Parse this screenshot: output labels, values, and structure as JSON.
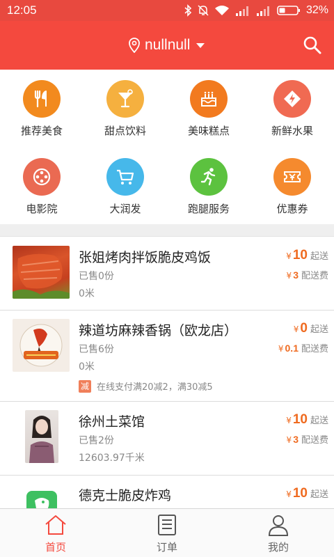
{
  "status_bar": {
    "time": "12:05",
    "battery": "32%"
  },
  "header": {
    "location": "nullnull"
  },
  "categories": [
    {
      "label": "推荐美食",
      "icon": "fork-knife-icon",
      "color": "#f28a1e"
    },
    {
      "label": "甜点饮料",
      "icon": "cocktail-icon",
      "color": "#f5b03f"
    },
    {
      "label": "美味糕点",
      "icon": "cake-icon",
      "color": "#f27a1f"
    },
    {
      "label": "新鲜水果",
      "icon": "lightning-tag-icon",
      "color": "#f06a52"
    },
    {
      "label": "电影院",
      "icon": "film-reel-icon",
      "color": "#ea6a52"
    },
    {
      "label": "大润发",
      "icon": "cart-icon",
      "color": "#46b8ea"
    },
    {
      "label": "跑腿服务",
      "icon": "runner-icon",
      "color": "#5cc23f"
    },
    {
      "label": "优惠券",
      "icon": "coupon-icon",
      "color": "#f58a2e"
    }
  ],
  "shops": [
    {
      "name": "张姐烤肉拌饭脆皮鸡饭",
      "sold": "已售0份",
      "distance": "0米",
      "min_price": "10",
      "min_unit": "起送",
      "delivery_fee": "3",
      "fee_unit": "配送费",
      "currency": "¥"
    },
    {
      "name": "辣道坊麻辣香锅（欧龙店）",
      "sold": "已售6份",
      "distance": "0米",
      "min_price": "0",
      "min_unit": "起送",
      "delivery_fee": "0.1",
      "fee_unit": "配送费",
      "currency": "¥",
      "promo_tag": "减",
      "promo_text": "在线支付满20减2，满30减5"
    },
    {
      "name": "徐州土菜馆",
      "sold": "已售2份",
      "distance": "12603.97千米",
      "min_price": "10",
      "min_unit": "起送",
      "delivery_fee": "3",
      "fee_unit": "配送费",
      "currency": "¥"
    },
    {
      "name": "德克士脆皮炸鸡",
      "min_price": "10",
      "min_unit": "起送",
      "currency": "¥"
    }
  ],
  "tabs": [
    {
      "label": "首页",
      "icon": "home-icon",
      "active": true
    },
    {
      "label": "订单",
      "icon": "order-list-icon",
      "active": false
    },
    {
      "label": "我的",
      "icon": "user-icon",
      "active": false
    }
  ],
  "colors": {
    "brand": "#f4493e",
    "price": "#ef6a1f"
  }
}
